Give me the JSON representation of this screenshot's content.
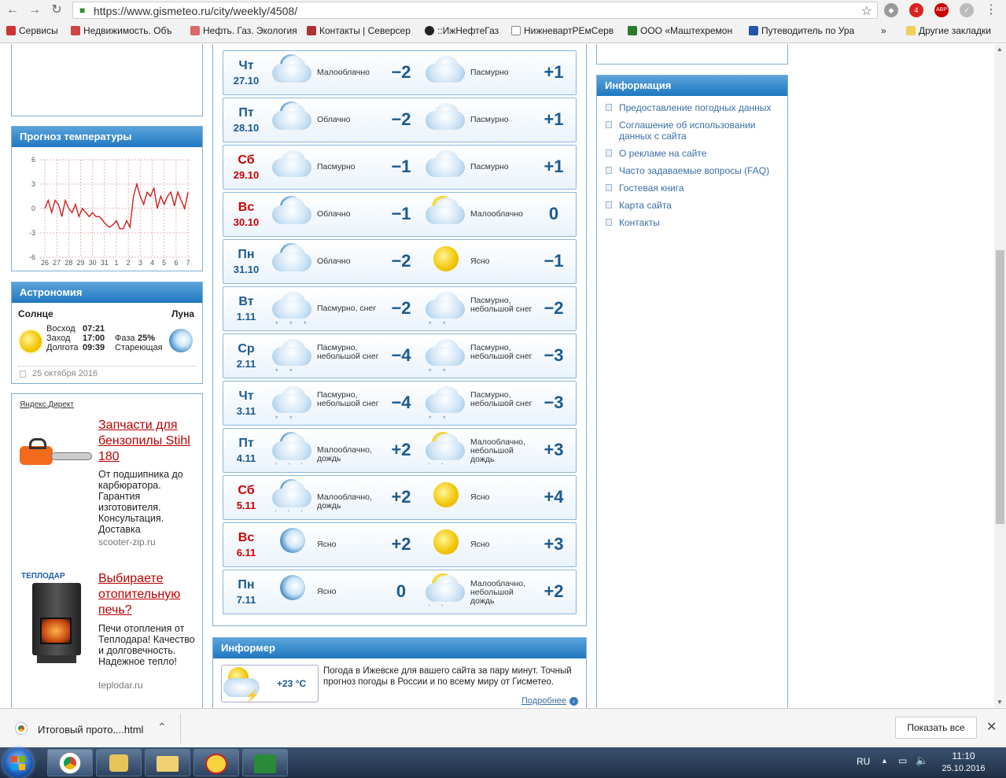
{
  "browser": {
    "url": "https://www.gismeteo.ru/city/weekly/4508/"
  },
  "bookmarks": [
    "Сервисы",
    "Недвижимость. Объ",
    "Нефть. Газ. Экология",
    "Контакты | Северсер",
    "::ИжНефтеГаз",
    "НижневартРЕмСерв",
    "ООО «Маштехремон",
    "Путеводитель по Ура",
    "»",
    "Другие закладки"
  ],
  "extensions": {
    "badge1": "4",
    "badge2": "4",
    "abp": "ABP"
  },
  "temp_box": {
    "title": "Прогноз температуры"
  },
  "chart_data": {
    "type": "line",
    "title": "Прогноз температуры",
    "yticks": [
      "6",
      "3",
      "0",
      "-3",
      "-6"
    ],
    "ylim": [
      -6,
      6
    ],
    "xticks": [
      "26",
      "27",
      "28",
      "29",
      "30",
      "31",
      "1",
      "2",
      "3",
      "4",
      "5",
      "6",
      "7"
    ],
    "values": [
      0,
      1,
      -0.5,
      1,
      0.5,
      -1,
      1,
      0,
      -0.5,
      0.5,
      -1,
      0,
      -0.5,
      -1,
      -0.5,
      -1,
      -1,
      -1.5,
      -2,
      -2.3,
      -2,
      -1.5,
      -2.5,
      -2.5,
      -1.5,
      -2.3,
      1.5,
      3,
      1.5,
      0.5,
      2,
      1.5,
      2.5,
      0,
      1.5,
      0.5,
      1.5,
      2,
      0.3,
      2,
      1,
      0,
      2
    ]
  },
  "astro": {
    "title": "Астрономия",
    "sun_label": "Солнце",
    "moon_label": "Луна",
    "rise_label": "Восход",
    "rise": "07:21",
    "set_label": "Заход",
    "set": "17:00",
    "length_label": "Долгота",
    "length": "09:39",
    "phase_label": "Фаза",
    "phase": "25%",
    "moon_state": "Стареющая",
    "date": "25 октября 2016"
  },
  "ads": {
    "label": "Яндекс.Директ",
    "items": [
      {
        "title": "Запчасти для бензопилы Stihl 180",
        "text": "От подшипника до карбюратора. Гарантия изготовителя. Консультация. Доставка",
        "url": "scooter-zip.ru"
      },
      {
        "brand": "ТЕПЛОДАР",
        "title": "Выбираете отопительную печь?",
        "text": "Печи отопления от Теплодара! Качество и долговечность. Надежное тепло!",
        "url": "teplodar.ru"
      }
    ]
  },
  "forecast": [
    {
      "day": "Чт",
      "date": "27.10",
      "d1": "Малооблачно",
      "t1": "−2",
      "d2": "Пасмурно",
      "t2": "+1",
      "i1": "sun-moon-cloud",
      "i2": "cloud",
      "p1": "",
      "p2": "",
      "red": false
    },
    {
      "day": "Пт",
      "date": "28.10",
      "d1": "Облачно",
      "t1": "−2",
      "d2": "Пасмурно",
      "t2": "+1",
      "i1": "moon-cloud",
      "i2": "cloud",
      "p1": "",
      "p2": "",
      "red": false
    },
    {
      "day": "Сб",
      "date": "29.10",
      "d1": "Пасмурно",
      "t1": "−1",
      "d2": "Пасмурно",
      "t2": "+1",
      "i1": "cloud",
      "i2": "cloud",
      "p1": "",
      "p2": "",
      "red": true
    },
    {
      "day": "Вс",
      "date": "30.10",
      "d1": "Облачно",
      "t1": "−1",
      "d2": "Малооблачно",
      "t2": "0",
      "i1": "moon-cloud",
      "i2": "sun-cloud",
      "p1": "",
      "p2": "",
      "red": true
    },
    {
      "day": "Пн",
      "date": "31.10",
      "d1": "Облачно",
      "t1": "−2",
      "d2": "Ясно",
      "t2": "−1",
      "i1": "moon-cloud",
      "i2": "sun",
      "p1": "",
      "p2": "",
      "red": false
    },
    {
      "day": "Вт",
      "date": "1.11",
      "d1": "Пасмурно, снег",
      "t1": "−2",
      "d2": "Пасмурно, небольшой снег",
      "t2": "−2",
      "i1": "cloud",
      "i2": "cloud",
      "p1": "* * *",
      "p2": "* *",
      "red": false
    },
    {
      "day": "Ср",
      "date": "2.11",
      "d1": "Пасмурно, небольшой снег",
      "t1": "−4",
      "d2": "Пасмурно, небольшой снег",
      "t2": "−3",
      "i1": "cloud",
      "i2": "cloud",
      "p1": "* *",
      "p2": "* *",
      "red": false
    },
    {
      "day": "Чт",
      "date": "3.11",
      "d1": "Пасмурно, небольшой снег",
      "t1": "−4",
      "d2": "Пасмурно, небольшой снег",
      "t2": "−3",
      "i1": "cloud",
      "i2": "cloud",
      "p1": "* *",
      "p2": "* *",
      "red": false
    },
    {
      "day": "Пт",
      "date": "4.11",
      "d1": "Малооблачно, дождь",
      "t1": "+2",
      "d2": "Малооблачно, небольшой дождь",
      "t2": "+3",
      "i1": "moon-cloud",
      "i2": "sun-cloud",
      "p1": "' ' '",
      "p2": "' '",
      "red": false
    },
    {
      "day": "Сб",
      "date": "5.11",
      "d1": "Малооблачно, дождь",
      "t1": "+2",
      "d2": "Ясно",
      "t2": "+4",
      "i1": "moon-cloud",
      "i2": "sun",
      "p1": "' ' '",
      "p2": "",
      "red": true
    },
    {
      "day": "Вс",
      "date": "6.11",
      "d1": "Ясно",
      "t1": "+2",
      "d2": "Ясно",
      "t2": "+3",
      "i1": "moon",
      "i2": "sun",
      "p1": "",
      "p2": "",
      "red": true
    },
    {
      "day": "Пн",
      "date": "7.11",
      "d1": "Ясно",
      "t1": "0",
      "d2": "Малооблачно, небольшой дождь",
      "t2": "+2",
      "i1": "moon",
      "i2": "sun-cloud",
      "p1": "",
      "p2": "' '",
      "red": false
    }
  ],
  "informer": {
    "title": "Информер",
    "temp": "+23 °C",
    "text": "Погода в Ижевске для вашего сайта за пару минут. Точный прогноз погоды в России и по всему миру от Гисметео.",
    "more": "Подробнее"
  },
  "info": {
    "title": "Информация",
    "items": [
      "Предоставление погодных данных",
      "Соглашение об использовании данных с сайта",
      "О рекламе на сайте",
      "Часто задаваемые вопросы (FAQ)",
      "Гостевая книга",
      "Карта сайта",
      "Контакты"
    ]
  },
  "download": {
    "file": "Итоговый прото....html",
    "show_all": "Показать все"
  },
  "tray": {
    "lang": "RU",
    "time": "11:10",
    "date": "25.10.2016"
  }
}
